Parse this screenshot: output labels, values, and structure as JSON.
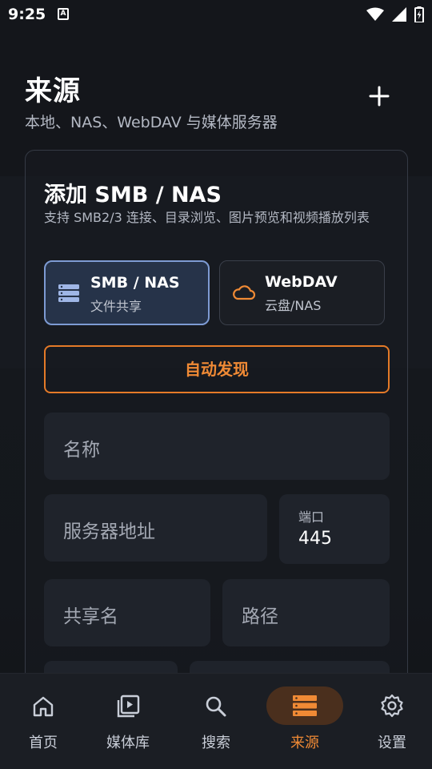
{
  "status_bar": {
    "time": "9:25",
    "notification_icon": "A"
  },
  "header": {
    "title": "来源",
    "subtitle": "本地、NAS、WebDAV 与媒体服务器"
  },
  "card": {
    "title": "添加 SMB / NAS",
    "description": "支持 SMB2/3 连接、目录浏览、图片预览和视频播放列表",
    "types": [
      {
        "label": "SMB / NAS",
        "sub": "文件共享",
        "icon": "server-icon",
        "selected": true
      },
      {
        "label": "WebDAV",
        "sub": "云盘/NAS",
        "icon": "cloud-icon",
        "selected": false
      }
    ],
    "discover_label": "自动发现",
    "fields": {
      "name_placeholder": "名称",
      "server_placeholder": "服务器地址",
      "port_label": "端口",
      "port_value": "445",
      "share_placeholder": "共享名",
      "path_placeholder": "路径"
    }
  },
  "bottom_nav": [
    {
      "label": "首页",
      "icon": "home-icon"
    },
    {
      "label": "媒体库",
      "icon": "media-library-icon"
    },
    {
      "label": "搜索",
      "icon": "search-icon"
    },
    {
      "label": "来源",
      "icon": "sources-icon",
      "active": true
    },
    {
      "label": "设置",
      "icon": "settings-icon"
    }
  ],
  "colors": {
    "accent": "#f08a35",
    "selected_border": "#7d9bd3",
    "background": "#14161b"
  }
}
